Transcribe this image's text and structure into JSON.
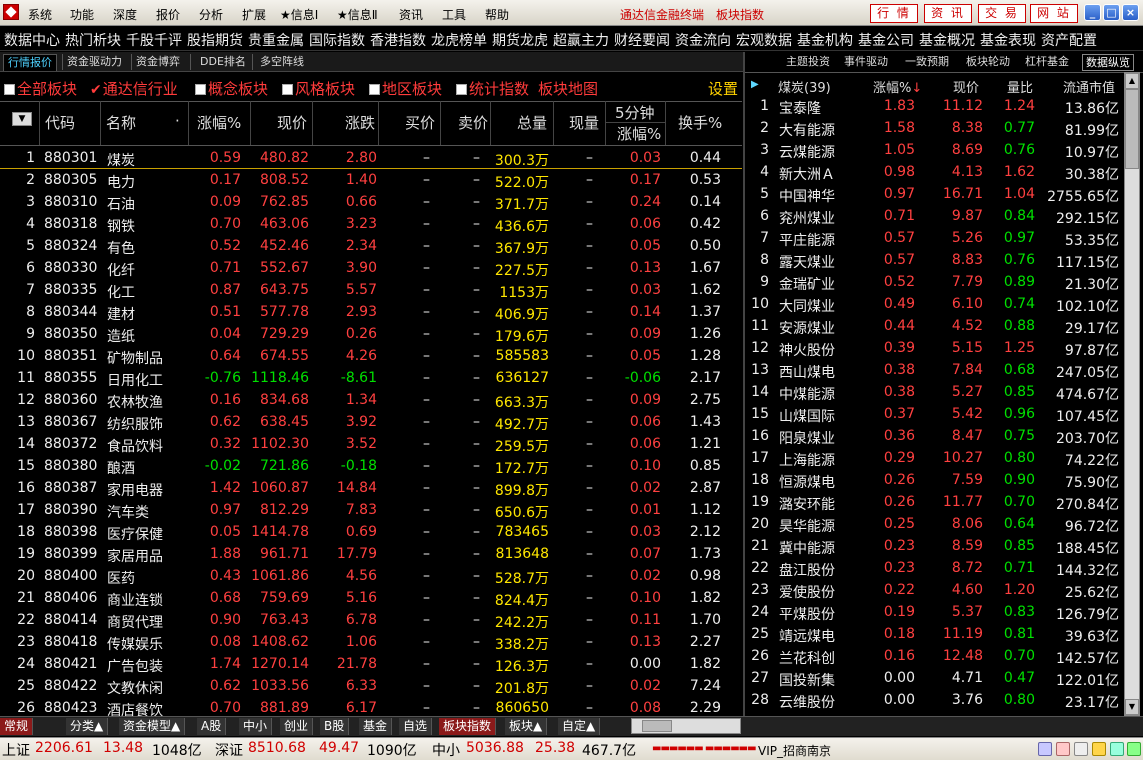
{
  "menubar": {
    "items": [
      "系统",
      "功能",
      "深度",
      "报价",
      "分析",
      "扩展",
      "★信息Ⅰ",
      "★信息Ⅱ",
      "资讯",
      "工具",
      "帮助"
    ],
    "brand": "通达信金融终端",
    "brand_sub": "板块指数",
    "buttons": [
      "行 情",
      "资 讯",
      "交 易",
      "网 站"
    ]
  },
  "navbar": {
    "items": [
      "数据中心",
      "热门析块",
      "千股千评",
      "股指期货",
      "贵重金属",
      "国际指数",
      "香港指数",
      "龙虎榜单",
      "期货龙虎",
      "超赢主力",
      "财经要闻",
      "资金流向",
      "宏观数据",
      "基金机构",
      "基金公司",
      "基金概况",
      "基金表现",
      "资产配置"
    ]
  },
  "tabs_left": [
    "行情报价",
    "资金驱动力",
    "资金博弈",
    "DDE排名",
    "多空阵线"
  ],
  "tabs_right": [
    "主题投资",
    "事件驱动",
    "一致预期",
    "板块轮动",
    "杠杆基金",
    "数据纵览"
  ],
  "filters": {
    "items": [
      "全部板块",
      "通达信行业",
      "概念板块",
      "风格板块",
      "地区板块",
      "统计指数"
    ],
    "map_link": "板块地图",
    "settings": "设置"
  },
  "table": {
    "headers": {
      "code": "代码",
      "name": "名称",
      "chg_pct": "涨幅%",
      "price": "现价",
      "change": "涨跌",
      "bid": "买价",
      "ask": "卖价",
      "volume": "总量",
      "cur_vol": "现量",
      "five_min_top": "5分钟",
      "five_min_bottom": "涨幅%",
      "turnover": "换手%"
    },
    "rows": [
      {
        "no": "1",
        "code": "880301",
        "name": "煤炭",
        "chg": "0.59",
        "price": "480.82",
        "change": "2.80",
        "bid": "–",
        "ask": "–",
        "vol": "300.3万",
        "cur": "–",
        "m5": "0.03",
        "turn": "0.44",
        "dir": "up",
        "m5dir": "up"
      },
      {
        "no": "2",
        "code": "880305",
        "name": "电力",
        "chg": "0.17",
        "price": "808.52",
        "change": "1.40",
        "bid": "–",
        "ask": "–",
        "vol": "522.0万",
        "cur": "–",
        "m5": "0.17",
        "turn": "0.53",
        "dir": "up",
        "m5dir": "up"
      },
      {
        "no": "3",
        "code": "880310",
        "name": "石油",
        "chg": "0.09",
        "price": "762.85",
        "change": "0.66",
        "bid": "–",
        "ask": "–",
        "vol": "371.7万",
        "cur": "–",
        "m5": "0.24",
        "turn": "0.14",
        "dir": "up",
        "m5dir": "up"
      },
      {
        "no": "4",
        "code": "880318",
        "name": "钢铁",
        "chg": "0.70",
        "price": "463.06",
        "change": "3.23",
        "bid": "–",
        "ask": "–",
        "vol": "436.6万",
        "cur": "–",
        "m5": "0.06",
        "turn": "0.42",
        "dir": "up",
        "m5dir": "up"
      },
      {
        "no": "5",
        "code": "880324",
        "name": "有色",
        "chg": "0.52",
        "price": "452.46",
        "change": "2.34",
        "bid": "–",
        "ask": "–",
        "vol": "367.9万",
        "cur": "–",
        "m5": "0.05",
        "turn": "0.50",
        "dir": "up",
        "m5dir": "up"
      },
      {
        "no": "6",
        "code": "880330",
        "name": "化纤",
        "chg": "0.71",
        "price": "552.67",
        "change": "3.90",
        "bid": "–",
        "ask": "–",
        "vol": "227.5万",
        "cur": "–",
        "m5": "0.13",
        "turn": "1.67",
        "dir": "up",
        "m5dir": "up"
      },
      {
        "no": "7",
        "code": "880335",
        "name": "化工",
        "chg": "0.87",
        "price": "643.75",
        "change": "5.57",
        "bid": "–",
        "ask": "–",
        "vol": "1153万",
        "cur": "–",
        "m5": "0.03",
        "turn": "1.62",
        "dir": "up",
        "m5dir": "up"
      },
      {
        "no": "8",
        "code": "880344",
        "name": "建材",
        "chg": "0.51",
        "price": "577.78",
        "change": "2.93",
        "bid": "–",
        "ask": "–",
        "vol": "406.9万",
        "cur": "–",
        "m5": "0.14",
        "turn": "1.37",
        "dir": "up",
        "m5dir": "up"
      },
      {
        "no": "9",
        "code": "880350",
        "name": "造纸",
        "chg": "0.04",
        "price": "729.29",
        "change": "0.26",
        "bid": "–",
        "ask": "–",
        "vol": "179.6万",
        "cur": "–",
        "m5": "0.09",
        "turn": "1.26",
        "dir": "up",
        "m5dir": "up"
      },
      {
        "no": "10",
        "code": "880351",
        "name": "矿物制品",
        "chg": "0.64",
        "price": "674.55",
        "change": "4.26",
        "bid": "–",
        "ask": "–",
        "vol": "585583",
        "cur": "–",
        "m5": "0.05",
        "turn": "1.28",
        "dir": "up",
        "m5dir": "up"
      },
      {
        "no": "11",
        "code": "880355",
        "name": "日用化工",
        "chg": "-0.76",
        "price": "1118.46",
        "change": "-8.61",
        "bid": "–",
        "ask": "–",
        "vol": "636127",
        "cur": "–",
        "m5": "-0.06",
        "turn": "2.17",
        "dir": "down",
        "m5dir": "down"
      },
      {
        "no": "12",
        "code": "880360",
        "name": "农林牧渔",
        "chg": "0.16",
        "price": "834.68",
        "change": "1.34",
        "bid": "–",
        "ask": "–",
        "vol": "663.3万",
        "cur": "–",
        "m5": "0.09",
        "turn": "2.75",
        "dir": "up",
        "m5dir": "up"
      },
      {
        "no": "13",
        "code": "880367",
        "name": "纺织服饰",
        "chg": "0.62",
        "price": "638.45",
        "change": "3.92",
        "bid": "–",
        "ask": "–",
        "vol": "492.7万",
        "cur": "–",
        "m5": "0.06",
        "turn": "1.43",
        "dir": "up",
        "m5dir": "up"
      },
      {
        "no": "14",
        "code": "880372",
        "name": "食品饮料",
        "chg": "0.32",
        "price": "1102.30",
        "change": "3.52",
        "bid": "–",
        "ask": "–",
        "vol": "259.5万",
        "cur": "–",
        "m5": "0.06",
        "turn": "1.21",
        "dir": "up",
        "m5dir": "up"
      },
      {
        "no": "15",
        "code": "880380",
        "name": "酿酒",
        "chg": "-0.02",
        "price": "721.86",
        "change": "-0.18",
        "bid": "–",
        "ask": "–",
        "vol": "172.7万",
        "cur": "–",
        "m5": "0.10",
        "turn": "0.85",
        "dir": "down",
        "m5dir": "up"
      },
      {
        "no": "16",
        "code": "880387",
        "name": "家用电器",
        "chg": "1.42",
        "price": "1060.87",
        "change": "14.84",
        "bid": "–",
        "ask": "–",
        "vol": "899.8万",
        "cur": "–",
        "m5": "0.02",
        "turn": "2.87",
        "dir": "up",
        "m5dir": "up"
      },
      {
        "no": "17",
        "code": "880390",
        "name": "汽车类",
        "chg": "0.97",
        "price": "812.29",
        "change": "7.83",
        "bid": "–",
        "ask": "–",
        "vol": "650.6万",
        "cur": "–",
        "m5": "0.01",
        "turn": "1.12",
        "dir": "up",
        "m5dir": "up"
      },
      {
        "no": "18",
        "code": "880398",
        "name": "医疗保健",
        "chg": "0.05",
        "price": "1414.78",
        "change": "0.69",
        "bid": "–",
        "ask": "–",
        "vol": "783465",
        "cur": "–",
        "m5": "0.03",
        "turn": "2.12",
        "dir": "up",
        "m5dir": "up"
      },
      {
        "no": "19",
        "code": "880399",
        "name": "家居用品",
        "chg": "1.88",
        "price": "961.71",
        "change": "17.79",
        "bid": "–",
        "ask": "–",
        "vol": "813648",
        "cur": "–",
        "m5": "0.07",
        "turn": "1.73",
        "dir": "up",
        "m5dir": "up"
      },
      {
        "no": "20",
        "code": "880400",
        "name": "医药",
        "chg": "0.43",
        "price": "1061.86",
        "change": "4.56",
        "bid": "–",
        "ask": "–",
        "vol": "528.7万",
        "cur": "–",
        "m5": "0.02",
        "turn": "0.98",
        "dir": "up",
        "m5dir": "up"
      },
      {
        "no": "21",
        "code": "880406",
        "name": "商业连锁",
        "chg": "0.68",
        "price": "759.69",
        "change": "5.16",
        "bid": "–",
        "ask": "–",
        "vol": "824.4万",
        "cur": "–",
        "m5": "0.10",
        "turn": "1.82",
        "dir": "up",
        "m5dir": "up"
      },
      {
        "no": "22",
        "code": "880414",
        "name": "商贸代理",
        "chg": "0.90",
        "price": "763.43",
        "change": "6.78",
        "bid": "–",
        "ask": "–",
        "vol": "242.2万",
        "cur": "–",
        "m5": "0.11",
        "turn": "1.70",
        "dir": "up",
        "m5dir": "up"
      },
      {
        "no": "23",
        "code": "880418",
        "name": "传媒娱乐",
        "chg": "0.08",
        "price": "1408.62",
        "change": "1.06",
        "bid": "–",
        "ask": "–",
        "vol": "338.2万",
        "cur": "–",
        "m5": "0.13",
        "turn": "2.27",
        "dir": "up",
        "m5dir": "up"
      },
      {
        "no": "24",
        "code": "880421",
        "name": "广告包装",
        "chg": "1.74",
        "price": "1270.14",
        "change": "21.78",
        "bid": "–",
        "ask": "–",
        "vol": "126.3万",
        "cur": "–",
        "m5": "0.00",
        "turn": "1.82",
        "dir": "up",
        "m5dir": "flat"
      },
      {
        "no": "25",
        "code": "880422",
        "name": "文教休闲",
        "chg": "0.62",
        "price": "1033.56",
        "change": "6.33",
        "bid": "–",
        "ask": "–",
        "vol": "201.8万",
        "cur": "–",
        "m5": "0.02",
        "turn": "7.24",
        "dir": "up",
        "m5dir": "up"
      },
      {
        "no": "26",
        "code": "880423",
        "name": "酒店餐饮",
        "chg": "0.70",
        "price": "881.89",
        "change": "6.17",
        "bid": "–",
        "ask": "–",
        "vol": "860650",
        "cur": "–",
        "m5": "0.08",
        "turn": "2.29",
        "dir": "up",
        "m5dir": "up"
      }
    ]
  },
  "right": {
    "headers": {
      "name": "煤炭(39)",
      "chg": "涨幅%",
      "price": "现价",
      "vratio": "量比",
      "mcap": "流通市值"
    },
    "rows": [
      {
        "no": "1",
        "name": "宝泰隆",
        "chg": "1.83",
        "price": "11.12",
        "vr": "1.24",
        "cap": "13.86亿",
        "dir": "up",
        "vrdir": "up"
      },
      {
        "no": "2",
        "name": "大有能源",
        "chg": "1.58",
        "price": "8.38",
        "vr": "0.77",
        "cap": "81.99亿",
        "dir": "up",
        "vrdir": "down"
      },
      {
        "no": "3",
        "name": "云煤能源",
        "chg": "1.05",
        "price": "8.69",
        "vr": "0.76",
        "cap": "10.97亿",
        "dir": "up",
        "vrdir": "down"
      },
      {
        "no": "4",
        "name": "新大洲Ａ",
        "chg": "0.98",
        "price": "4.13",
        "vr": "1.62",
        "cap": "30.38亿",
        "dir": "up",
        "vrdir": "up"
      },
      {
        "no": "5",
        "name": "中国神华",
        "chg": "0.97",
        "price": "16.71",
        "vr": "1.04",
        "cap": "2755.65亿",
        "dir": "up",
        "vrdir": "up"
      },
      {
        "no": "6",
        "name": "兖州煤业",
        "chg": "0.71",
        "price": "9.87",
        "vr": "0.84",
        "cap": "292.15亿",
        "dir": "up",
        "vrdir": "down"
      },
      {
        "no": "7",
        "name": "平庄能源",
        "chg": "0.57",
        "price": "5.26",
        "vr": "0.97",
        "cap": "53.35亿",
        "dir": "up",
        "vrdir": "down"
      },
      {
        "no": "8",
        "name": "露天煤业",
        "chg": "0.57",
        "price": "8.83",
        "vr": "0.76",
        "cap": "117.15亿",
        "dir": "up",
        "vrdir": "down"
      },
      {
        "no": "9",
        "name": "金瑞矿业",
        "chg": "0.52",
        "price": "7.79",
        "vr": "0.89",
        "cap": "21.30亿",
        "dir": "up",
        "vrdir": "down"
      },
      {
        "no": "10",
        "name": "大同煤业",
        "chg": "0.49",
        "price": "6.10",
        "vr": "0.74",
        "cap": "102.10亿",
        "dir": "up",
        "vrdir": "down"
      },
      {
        "no": "11",
        "name": "安源煤业",
        "chg": "0.44",
        "price": "4.52",
        "vr": "0.88",
        "cap": "29.17亿",
        "dir": "up",
        "vrdir": "down"
      },
      {
        "no": "12",
        "name": "神火股份",
        "chg": "0.39",
        "price": "5.15",
        "vr": "1.25",
        "cap": "97.87亿",
        "dir": "up",
        "vrdir": "up"
      },
      {
        "no": "13",
        "name": "西山煤电",
        "chg": "0.38",
        "price": "7.84",
        "vr": "0.68",
        "cap": "247.05亿",
        "dir": "up",
        "vrdir": "down"
      },
      {
        "no": "14",
        "name": "中煤能源",
        "chg": "0.38",
        "price": "5.27",
        "vr": "0.85",
        "cap": "474.67亿",
        "dir": "up",
        "vrdir": "down"
      },
      {
        "no": "15",
        "name": "山煤国际",
        "chg": "0.37",
        "price": "5.42",
        "vr": "0.96",
        "cap": "107.45亿",
        "dir": "up",
        "vrdir": "down"
      },
      {
        "no": "16",
        "name": "阳泉煤业",
        "chg": "0.36",
        "price": "8.47",
        "vr": "0.75",
        "cap": "203.70亿",
        "dir": "up",
        "vrdir": "down"
      },
      {
        "no": "17",
        "name": "上海能源",
        "chg": "0.29",
        "price": "10.27",
        "vr": "0.80",
        "cap": "74.22亿",
        "dir": "up",
        "vrdir": "down"
      },
      {
        "no": "18",
        "name": "恒源煤电",
        "chg": "0.26",
        "price": "7.59",
        "vr": "0.90",
        "cap": "75.90亿",
        "dir": "up",
        "vrdir": "down"
      },
      {
        "no": "19",
        "name": "潞安环能",
        "chg": "0.26",
        "price": "11.77",
        "vr": "0.70",
        "cap": "270.84亿",
        "dir": "up",
        "vrdir": "down"
      },
      {
        "no": "20",
        "name": "昊华能源",
        "chg": "0.25",
        "price": "8.06",
        "vr": "0.64",
        "cap": "96.72亿",
        "dir": "up",
        "vrdir": "down"
      },
      {
        "no": "21",
        "name": "冀中能源",
        "chg": "0.23",
        "price": "8.59",
        "vr": "0.85",
        "cap": "188.45亿",
        "dir": "up",
        "vrdir": "down"
      },
      {
        "no": "22",
        "name": "盘江股份",
        "chg": "0.23",
        "price": "8.72",
        "vr": "0.71",
        "cap": "144.32亿",
        "dir": "up",
        "vrdir": "down"
      },
      {
        "no": "23",
        "name": "爱使股份",
        "chg": "0.22",
        "price": "4.60",
        "vr": "1.20",
        "cap": "25.62亿",
        "dir": "up",
        "vrdir": "up"
      },
      {
        "no": "24",
        "name": "平煤股份",
        "chg": "0.19",
        "price": "5.37",
        "vr": "0.83",
        "cap": "126.79亿",
        "dir": "up",
        "vrdir": "down"
      },
      {
        "no": "25",
        "name": "靖远煤电",
        "chg": "0.18",
        "price": "11.19",
        "vr": "0.81",
        "cap": "39.63亿",
        "dir": "up",
        "vrdir": "down"
      },
      {
        "no": "26",
        "name": "兰花科创",
        "chg": "0.16",
        "price": "12.48",
        "vr": "0.70",
        "cap": "142.57亿",
        "dir": "up",
        "vrdir": "down"
      },
      {
        "no": "27",
        "name": "国投新集",
        "chg": "0.00",
        "price": "4.71",
        "vr": "0.47",
        "cap": "122.01亿",
        "dir": "flat",
        "vrdir": "down"
      },
      {
        "no": "28",
        "name": "云维股份",
        "chg": "0.00",
        "price": "3.76",
        "vr": "0.80",
        "cap": "23.17亿",
        "dir": "flat",
        "vrdir": "down"
      }
    ]
  },
  "bottom_tabs": [
    "常规",
    "分类▲",
    "资金模型▲",
    "A股",
    "中小",
    "创业",
    "B股",
    "基金",
    "自选",
    "板块指数",
    "板块▲",
    "自定▲"
  ],
  "status": {
    "sh_label": "上证",
    "sh_val": "2206.61",
    "sh_chg": "13.48",
    "sh_amt": "1048亿",
    "sz_label": "深证",
    "sz_val": "8510.68",
    "sz_chg": "49.47",
    "sz_amt": "1090亿",
    "zx_label": "中小",
    "zx_val": "5036.88",
    "zx_chg": "25.38",
    "zx_amt": "467.7亿",
    "vip": "VIP_招商南京"
  },
  "colors": {
    "up": "#ff4040",
    "down": "#00e000",
    "flat": "#eeeeee",
    "volume": "#ffe600"
  }
}
